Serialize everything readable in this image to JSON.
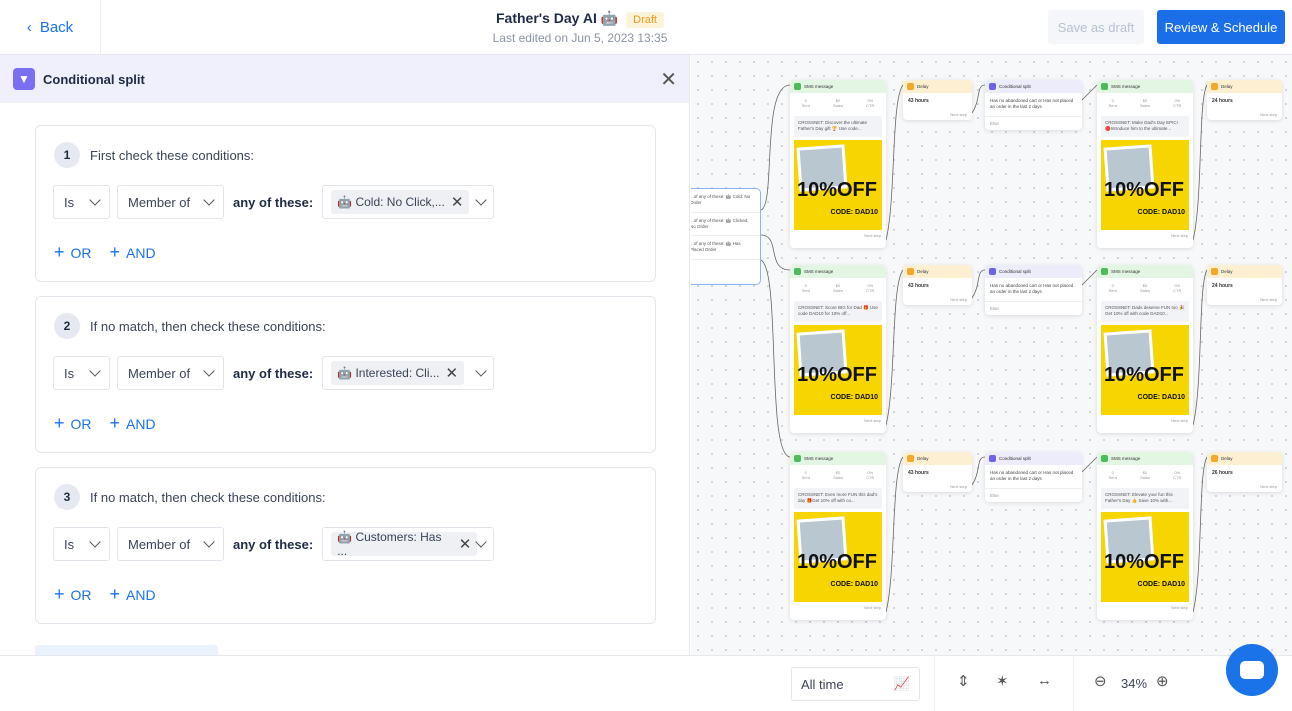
{
  "header": {
    "back_label": "Back",
    "title": "Father's Day AI 🤖",
    "status": "Draft",
    "last_edited": "Last edited on Jun 5, 2023 13:35",
    "save_draft": "Save as draft",
    "review": "Review & Schedule"
  },
  "panel": {
    "title": "Conditional split",
    "blocks": [
      {
        "number": "1",
        "heading": "First check these conditions:",
        "operator": "Is",
        "relation": "Member of",
        "any_label": "any of these:",
        "chip": "🤖 Cold: No Click,...",
        "or": "OR",
        "and": "AND"
      },
      {
        "number": "2",
        "heading": "If no match, then check these conditions:",
        "operator": "Is",
        "relation": "Member of",
        "any_label": "any of these:",
        "chip": "🤖 Interested: Cli...",
        "or": "OR",
        "and": "AND"
      },
      {
        "number": "3",
        "heading": "If no match, then check these conditions:",
        "operator": "Is",
        "relation": "Member of",
        "any_label": "any of these:",
        "chip": "🤖 Customers: Has ...",
        "or": "OR",
        "and": "AND"
      }
    ]
  },
  "canvas": {
    "split": {
      "rows": [
        "...of any of these: 🤖 Cold: No Order",
        "...of any of these: 🤖 Clicked, No Order",
        "...of any of these: 🤖 Has Placed Order"
      ]
    },
    "labels": {
      "sms": "SMS message",
      "delay": "Delay",
      "cond": "Conditional split",
      "next": "Next step",
      "else": "Else",
      "sent": "Sent",
      "sales": "Sales",
      "ctr": "CTR",
      "sent_v": "0",
      "sales_v": "$0",
      "ctr_v": "0%",
      "cond_text": "Has no abandoned cart or Has not placed an order in the last 2 days",
      "off": "10%OFF",
      "code": "CODE: DAD10"
    },
    "rows": [
      {
        "sms1": "CROSSNET: Discover the ultimate Father's Day gift 🏆 Use code...",
        "delay1": "43 hours",
        "sms2": "CROSSNET: Make Dad's Day EPIC! 🔴Introduce him to the ultimate...",
        "delay2": "24 hours"
      },
      {
        "sms1": "CROSSNET: Score BIG for Dad 🎁 Use code DAD10 for 10% off...",
        "delay1": "43 hours",
        "sms2": "CROSSNET: Dads deserve FUN too 🎉Get 10% off with code DAD10...",
        "delay2": "24 hours"
      },
      {
        "sms1": "CROSSNET: Even more FUN this dad's day 🎁Get 10% off with co...",
        "delay1": "43 hours",
        "sms2": "CROSSNET: Elevate your fun this Father's Day 👍 Save 10% with...",
        "delay2": "26 hours"
      }
    ]
  },
  "footer": {
    "range": "All time",
    "zoom": "34%"
  }
}
